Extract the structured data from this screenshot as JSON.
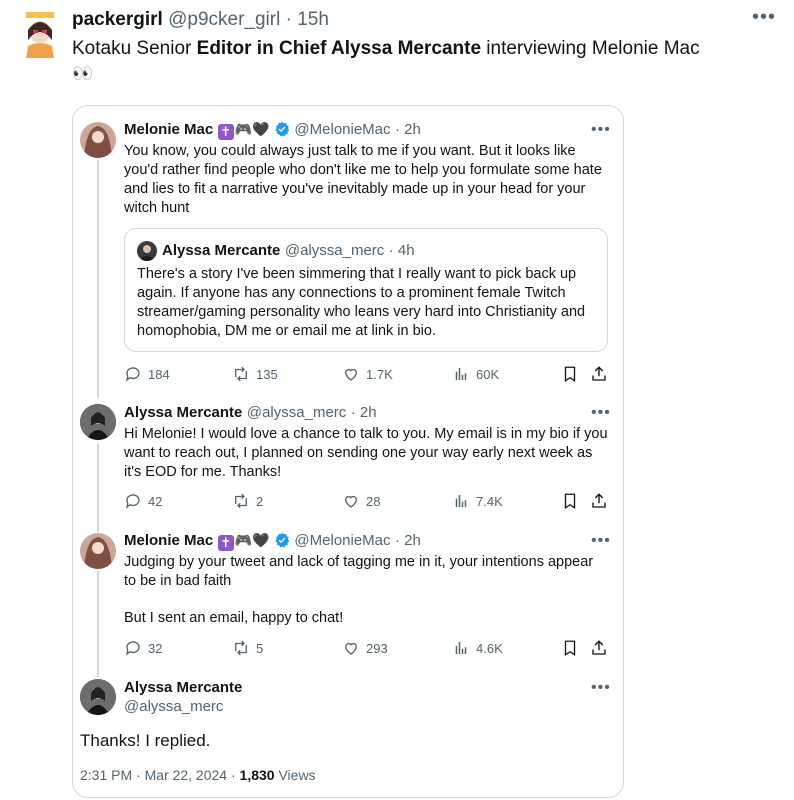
{
  "top": {
    "author": "packergirl",
    "handle": "@p9cker_girl",
    "time": "· 15h",
    "text_prefix": "Kotaku Senior ",
    "text_bold": "Editor in Chief Alyssa Mercante",
    "text_suffix": " interviewing Melonie Mac",
    "emoji_line": "👀"
  },
  "card": {
    "post1": {
      "name": "Melonie Mac",
      "handle": "@MelonieMac",
      "time": "· 2h",
      "text": "You know, you could always just talk to me if you want. But it looks like you'd rather find people who don't like me to help you formulate some hate and lies to fit a narrative you've inevitably made up in your head for your witch hunt",
      "quote": {
        "name": "Alyssa Mercante",
        "handle": "@alyssa_merc",
        "time": "· 4h",
        "text": "There's a story I've been simmering that I really want to pick back up again. If anyone has any connections to a prominent female Twitch streamer/gaming personality who leans very hard into Christianity and homophobia, DM me or email me at link in bio."
      },
      "metrics": {
        "replies": "184",
        "reposts": "135",
        "likes": "1.7K",
        "views": "60K"
      }
    },
    "post2": {
      "name": "Alyssa Mercante",
      "handle": "@alyssa_merc",
      "time": "· 2h",
      "text": "Hi Melonie! I would love a chance to talk to you. My email is in my bio if you want to reach out, I planned on sending one your way early next week as it's EOD for me. Thanks!",
      "metrics": {
        "replies": "42",
        "reposts": "2",
        "likes": "28",
        "views": "7.4K"
      }
    },
    "post3": {
      "name": "Melonie Mac",
      "handle": "@MelonieMac",
      "time": "· 2h",
      "text1": "Judging by your tweet and lack of tagging me in it, your intentions appear to be in bad faith",
      "text2": "But I sent an email, happy to chat!",
      "metrics": {
        "replies": "32",
        "reposts": "5",
        "likes": "293",
        "views": "4.6K"
      }
    },
    "post4": {
      "name": "Alyssa Mercante",
      "handle": "@alyssa_merc",
      "text": "Thanks! I replied.",
      "timestamp": "2:31 PM · Mar 22, 2024 · ",
      "views_count": "1,830",
      "views_label": " Views"
    }
  },
  "colors": {
    "verified": "#1d9bf0",
    "border": "#cfd9de",
    "muted": "#536471"
  }
}
